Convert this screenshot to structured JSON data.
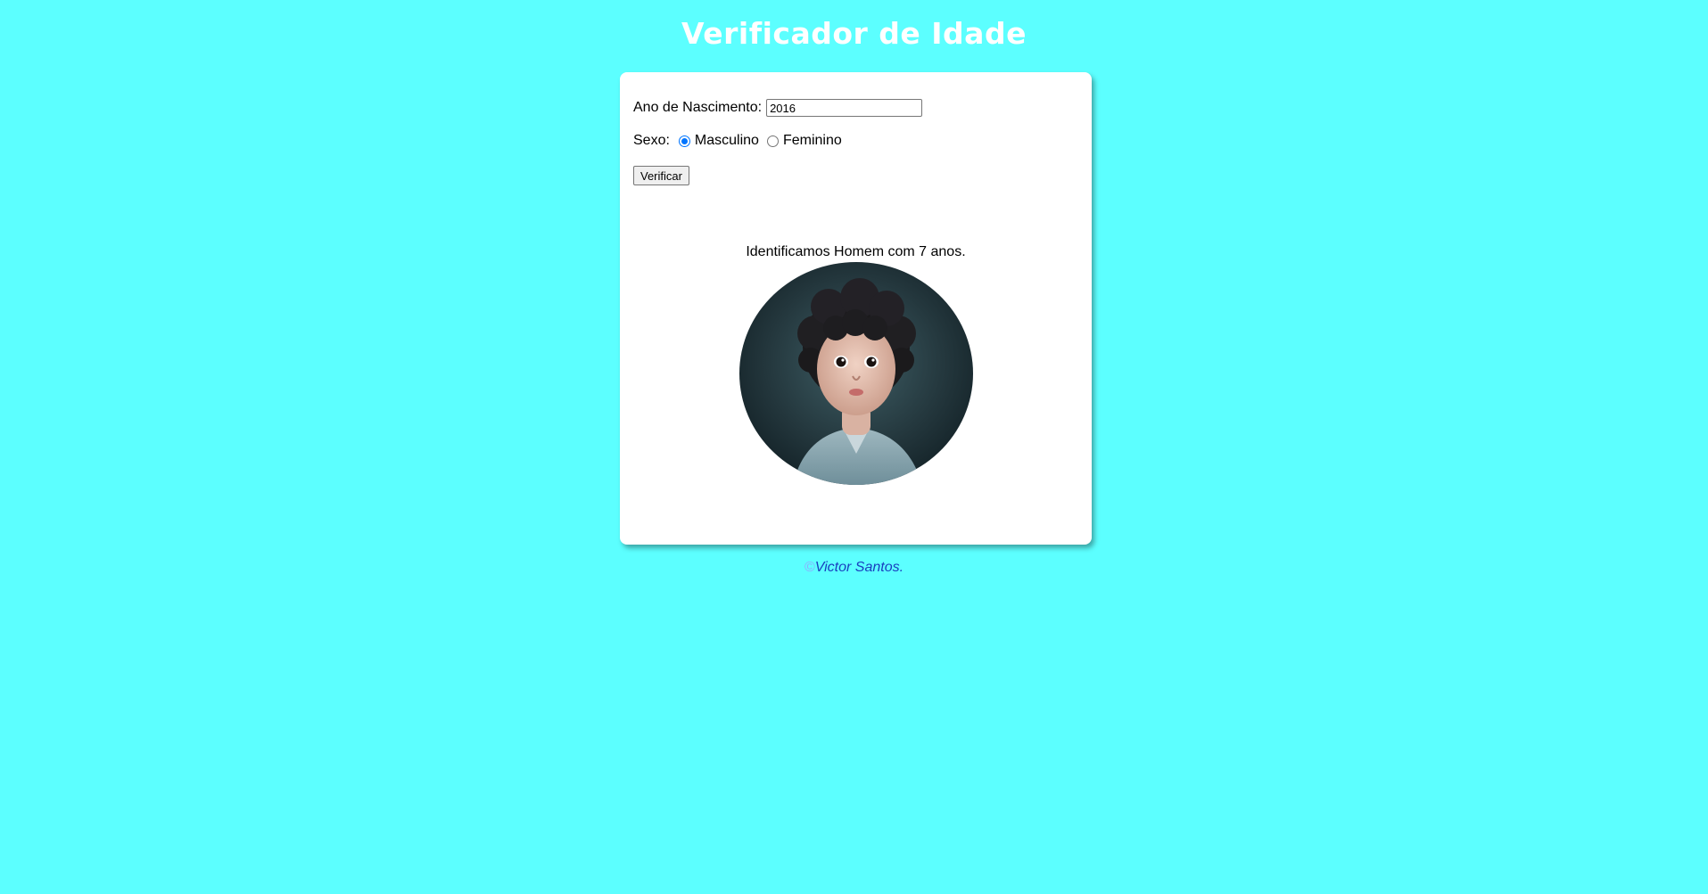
{
  "header": {
    "title": "Verificador de Idade"
  },
  "form": {
    "year_label": "Ano de Nascimento:",
    "year_value": "2016",
    "sex_label": "Sexo:",
    "sex_options": [
      {
        "label": "Masculino",
        "checked": true
      },
      {
        "label": "Feminino",
        "checked": false
      }
    ],
    "submit_label": "Verificar"
  },
  "result": {
    "text": "Identificamos Homem com 7 anos."
  },
  "footer": {
    "symbol": "©",
    "author": "Victor Santos."
  },
  "colors": {
    "background": "#5cffff",
    "card": "#ffffff",
    "title": "#ffffff",
    "radio_accent": "#0075ff",
    "footer_link": "#1a3fbf"
  }
}
